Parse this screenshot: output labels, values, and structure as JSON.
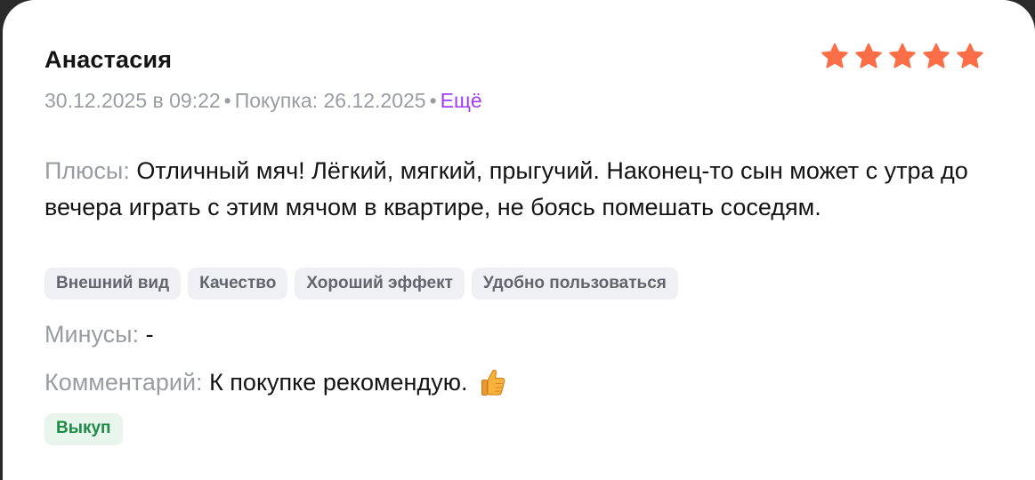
{
  "review": {
    "author": "Анастасия",
    "rating": 5,
    "rating_max": 5,
    "star_color": "#fb6e47",
    "meta": {
      "date": "30.12.2025 в 09:22",
      "purchase": "Покупка: 26.12.2025",
      "more": "Ещё"
    },
    "pros": {
      "label": "Плюсы:",
      "text": "Отличный мяч! Лёгкий, мягкий, прыгучий. Наконец-то сын может с утра до вечера играть с этим мячом в квартире, не боясь помешать соседям."
    },
    "tags": [
      "Внешний вид",
      "Качество",
      "Хороший эффект",
      "Удобно пользоваться"
    ],
    "cons": {
      "label": "Минусы:",
      "text": "-"
    },
    "comment": {
      "label": "Комментарий:",
      "text": "К покупке рекомендую.",
      "emoji": "thumbs-up-icon"
    },
    "badge": "Выкуп"
  }
}
